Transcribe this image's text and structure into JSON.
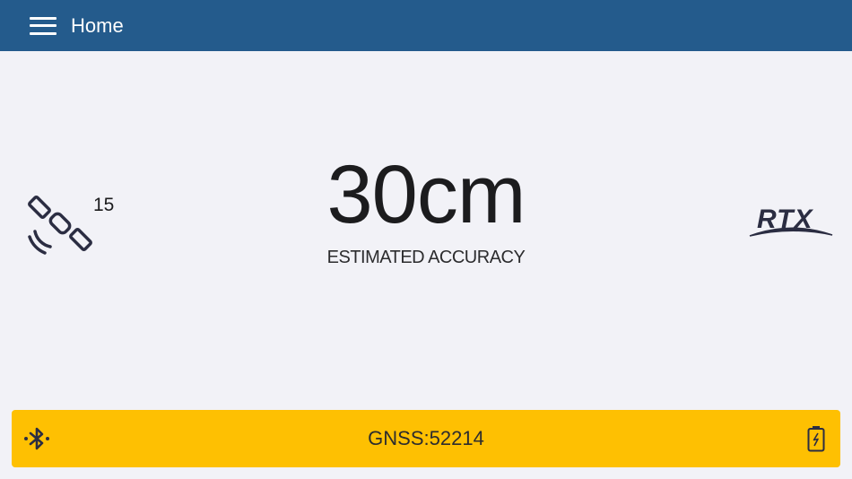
{
  "header": {
    "title": "Home"
  },
  "satellites": {
    "count": "15",
    "icon": "satellite-icon"
  },
  "accuracy": {
    "value": "30cm",
    "label": "ESTIMATED ACCURACY"
  },
  "logo": {
    "text": "RTX"
  },
  "status_bar": {
    "text": "GNSS:52214",
    "left_icon": "bluetooth-icon",
    "right_icon": "battery-charging-icon",
    "color": "#fec002"
  },
  "colors": {
    "header": "#245b8c",
    "background": "#f2f2f7"
  }
}
